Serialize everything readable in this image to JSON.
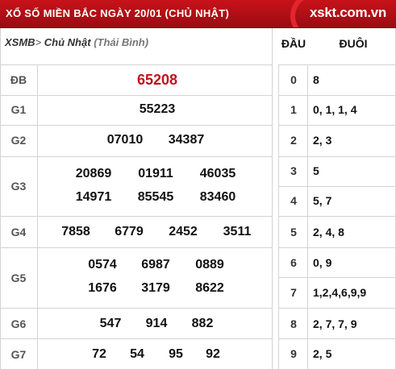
{
  "header": {
    "title": "XỔ SỐ MIỀN BẮC NGÀY 20/01 (CHỦ NHẬT)",
    "logo": "xskt.com.vn"
  },
  "subheader": {
    "xsmb": "XSMB",
    "separator": ">",
    "day": "Chủ Nhật",
    "province": "(Thái Bình)",
    "dau_label": "ĐẦU",
    "duoi_label": "ĐUÔI"
  },
  "prizes": {
    "db": {
      "label": "ĐB",
      "numbers": [
        "65208"
      ]
    },
    "g1": {
      "label": "G1",
      "numbers": [
        "55223"
      ]
    },
    "g2": {
      "label": "G2",
      "numbers": [
        "07010",
        "34387"
      ]
    },
    "g3": {
      "label": "G3",
      "numbers": [
        "20869",
        "01911",
        "46035",
        "14971",
        "85545",
        "83460"
      ]
    },
    "g4": {
      "label": "G4",
      "numbers": [
        "7858",
        "6779",
        "2452",
        "3511"
      ]
    },
    "g5": {
      "label": "G5",
      "numbers": [
        "0574",
        "6987",
        "0889",
        "1676",
        "3179",
        "8622"
      ]
    },
    "g6": {
      "label": "G6",
      "numbers": [
        "547",
        "914",
        "882"
      ]
    },
    "g7": {
      "label": "G7",
      "numbers": [
        "72",
        "54",
        "95",
        "92"
      ]
    }
  },
  "loto": [
    {
      "dau": "0",
      "duoi": "8"
    },
    {
      "dau": "1",
      "duoi": "0, 1, 1, 4"
    },
    {
      "dau": "2",
      "duoi": "2, 3"
    },
    {
      "dau": "3",
      "duoi": "5"
    },
    {
      "dau": "4",
      "duoi": "5, 7"
    },
    {
      "dau": "5",
      "duoi": "2, 4, 8"
    },
    {
      "dau": "6",
      "duoi": "0, 9"
    },
    {
      "dau": "7",
      "duoi": "1,2,4,6,9,9"
    },
    {
      "dau": "8",
      "duoi": "2, 7, 7, 9"
    },
    {
      "dau": "9",
      "duoi": "2, 5"
    }
  ],
  "colors": {
    "header_red": "#c8121a",
    "special_red": "#c1121b",
    "grid": "#d3d3d3"
  }
}
